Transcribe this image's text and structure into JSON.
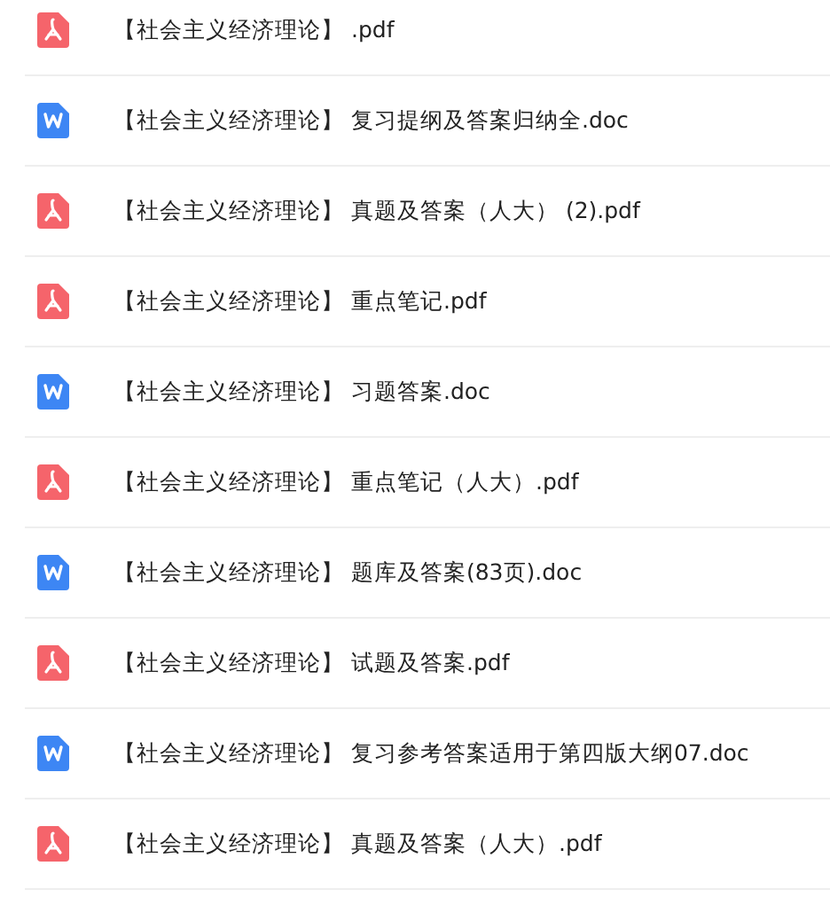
{
  "files": [
    {
      "kind": "pdf",
      "name": "【社会主义经济理论】 .pdf"
    },
    {
      "kind": "doc",
      "name": "【社会主义经济理论】 复习提纲及答案归纳全.doc"
    },
    {
      "kind": "pdf",
      "name": "【社会主义经济理论】 真题及答案（人大） (2).pdf"
    },
    {
      "kind": "pdf",
      "name": "【社会主义经济理论】 重点笔记.pdf"
    },
    {
      "kind": "doc",
      "name": "【社会主义经济理论】 习题答案.doc"
    },
    {
      "kind": "pdf",
      "name": "【社会主义经济理论】 重点笔记（人大）.pdf"
    },
    {
      "kind": "doc",
      "name": "【社会主义经济理论】 题库及答案(83页).doc"
    },
    {
      "kind": "pdf",
      "name": "【社会主义经济理论】 试题及答案.pdf"
    },
    {
      "kind": "doc",
      "name": "【社会主义经济理论】 复习参考答案适用于第四版大纲07.doc"
    },
    {
      "kind": "pdf",
      "name": "【社会主义经济理论】 真题及答案（人大）.pdf"
    }
  ]
}
